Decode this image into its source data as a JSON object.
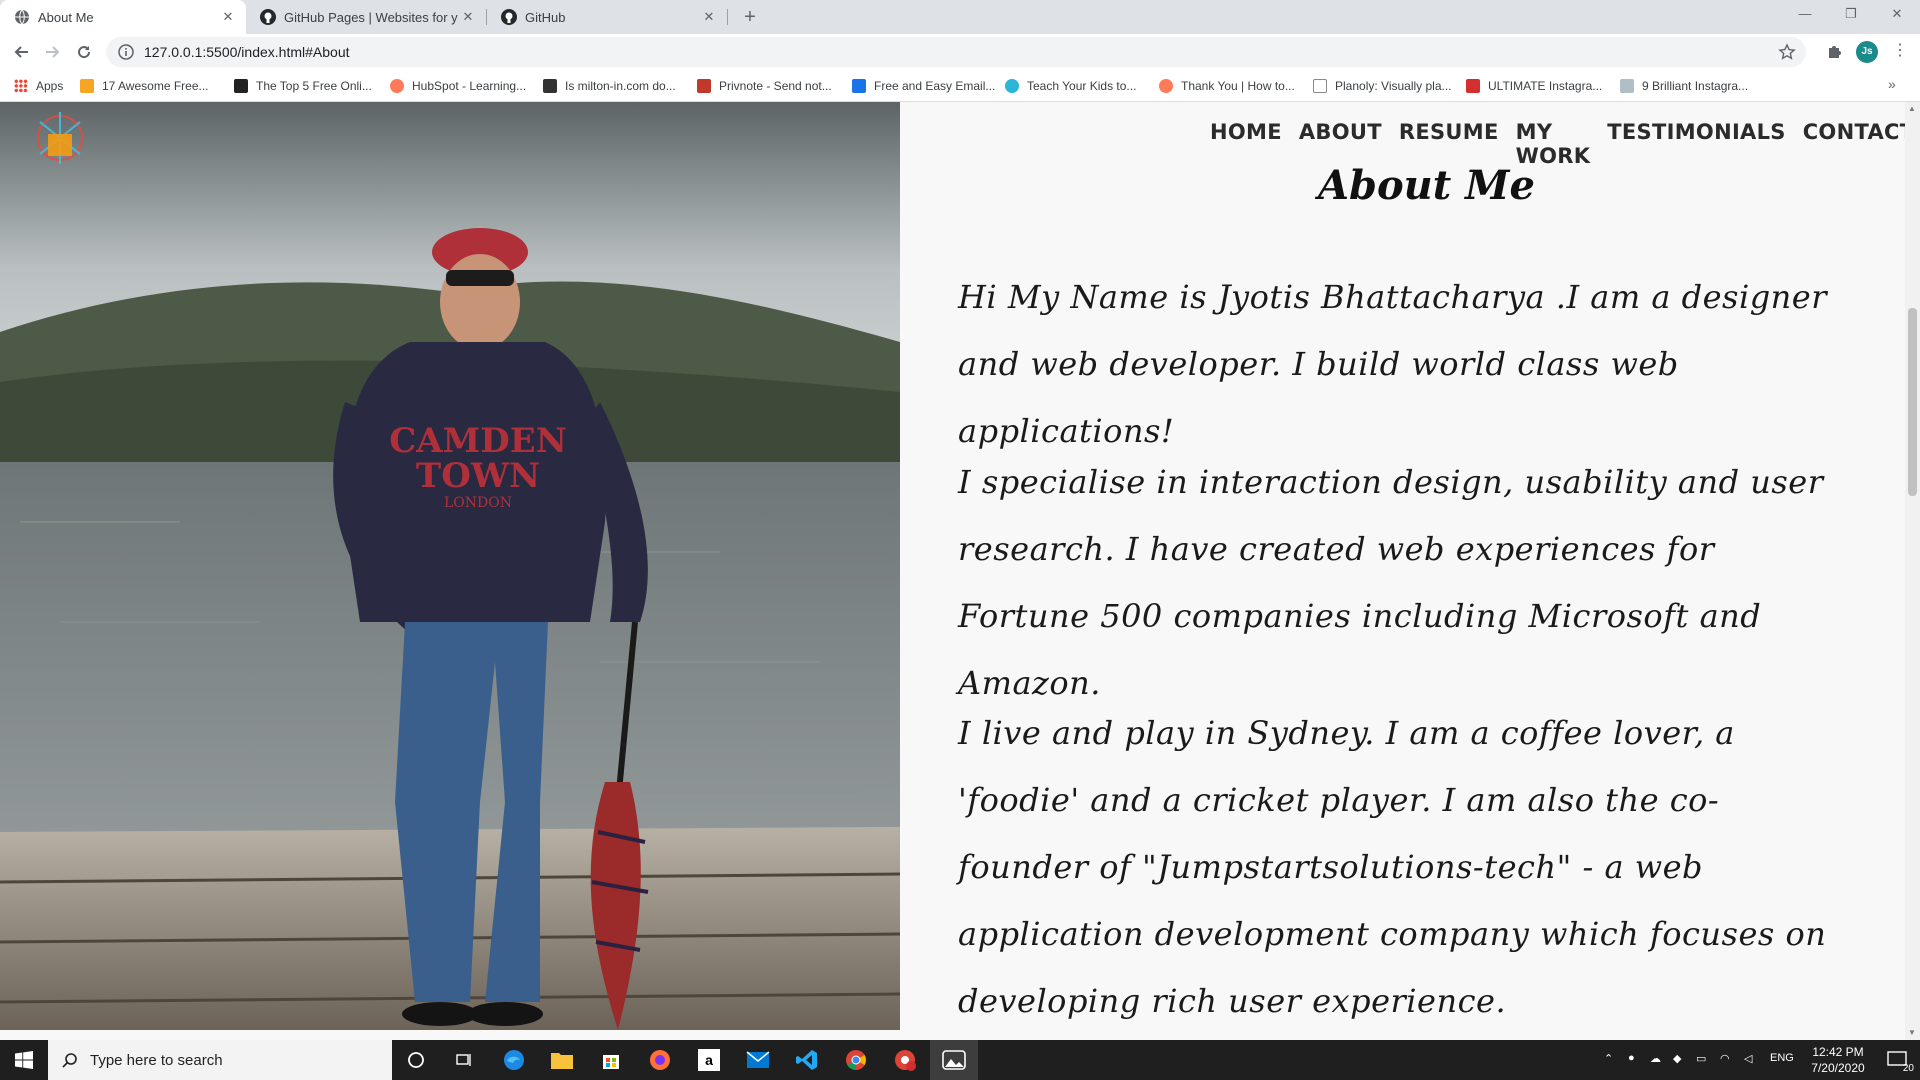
{
  "browser": {
    "tabs": [
      {
        "title": "About Me",
        "active": true
      },
      {
        "title": "GitHub Pages | Websites for you",
        "active": false
      },
      {
        "title": "GitHub",
        "active": false
      }
    ],
    "url": "127.0.0.1:5500/index.html#About",
    "profile_initials": "Js",
    "bookmarks": [
      {
        "label": "Apps",
        "color": "#ea4335"
      },
      {
        "label": "17 Awesome Free...",
        "color": "#f6a623"
      },
      {
        "label": "The Top 5 Free Onli...",
        "color": "#222222"
      },
      {
        "label": "HubSpot - Learning...",
        "color": "#ff7a59"
      },
      {
        "label": "Is milton-in.com do...",
        "color": "#333333"
      },
      {
        "label": "Privnote - Send not...",
        "color": "#c0392b"
      },
      {
        "label": "Free and Easy Email...",
        "color": "#1a73e8"
      },
      {
        "label": "Teach Your Kids to...",
        "color": "#2bb5d6"
      },
      {
        "label": "Thank You | How to...",
        "color": "#ff7a59"
      },
      {
        "label": "Planoly: Visually pla...",
        "color": "#888888"
      },
      {
        "label": "ULTIMATE Instagra...",
        "color": "#d32f2f"
      },
      {
        "label": "9 Brilliant Instagra...",
        "color": "#b0bec5"
      }
    ]
  },
  "page": {
    "nav": [
      "HOME",
      "ABOUT",
      "RESUME",
      "MY WORK",
      "TESTIMONIALS",
      "CONTACT"
    ],
    "heading": "About Me",
    "paragraphs": [
      "Hi My Name is Jyotis Bhattacharya .I am a designer and web developer. I build world class web applications!",
      "I specialise in interaction design, usability and user research. I have created web experiences for Fortune 500 companies including Microsoft and Amazon.",
      "I live and play in Sydney. I am a coffee lover, a 'foodie' and a cricket player. I am also the co-founder of \"Jumpstartsolutions-tech\" - a web application development company which focuses on developing rich user experience."
    ],
    "photo_text": {
      "hoodie_line1": "CAMDEN",
      "hoodie_line2": "TOWN",
      "hoodie_line3": "LONDON"
    }
  },
  "taskbar": {
    "search_placeholder": "Type here to search",
    "language": "ENG",
    "time": "12:42 PM",
    "date": "7/20/2020",
    "notification_count": "20"
  }
}
